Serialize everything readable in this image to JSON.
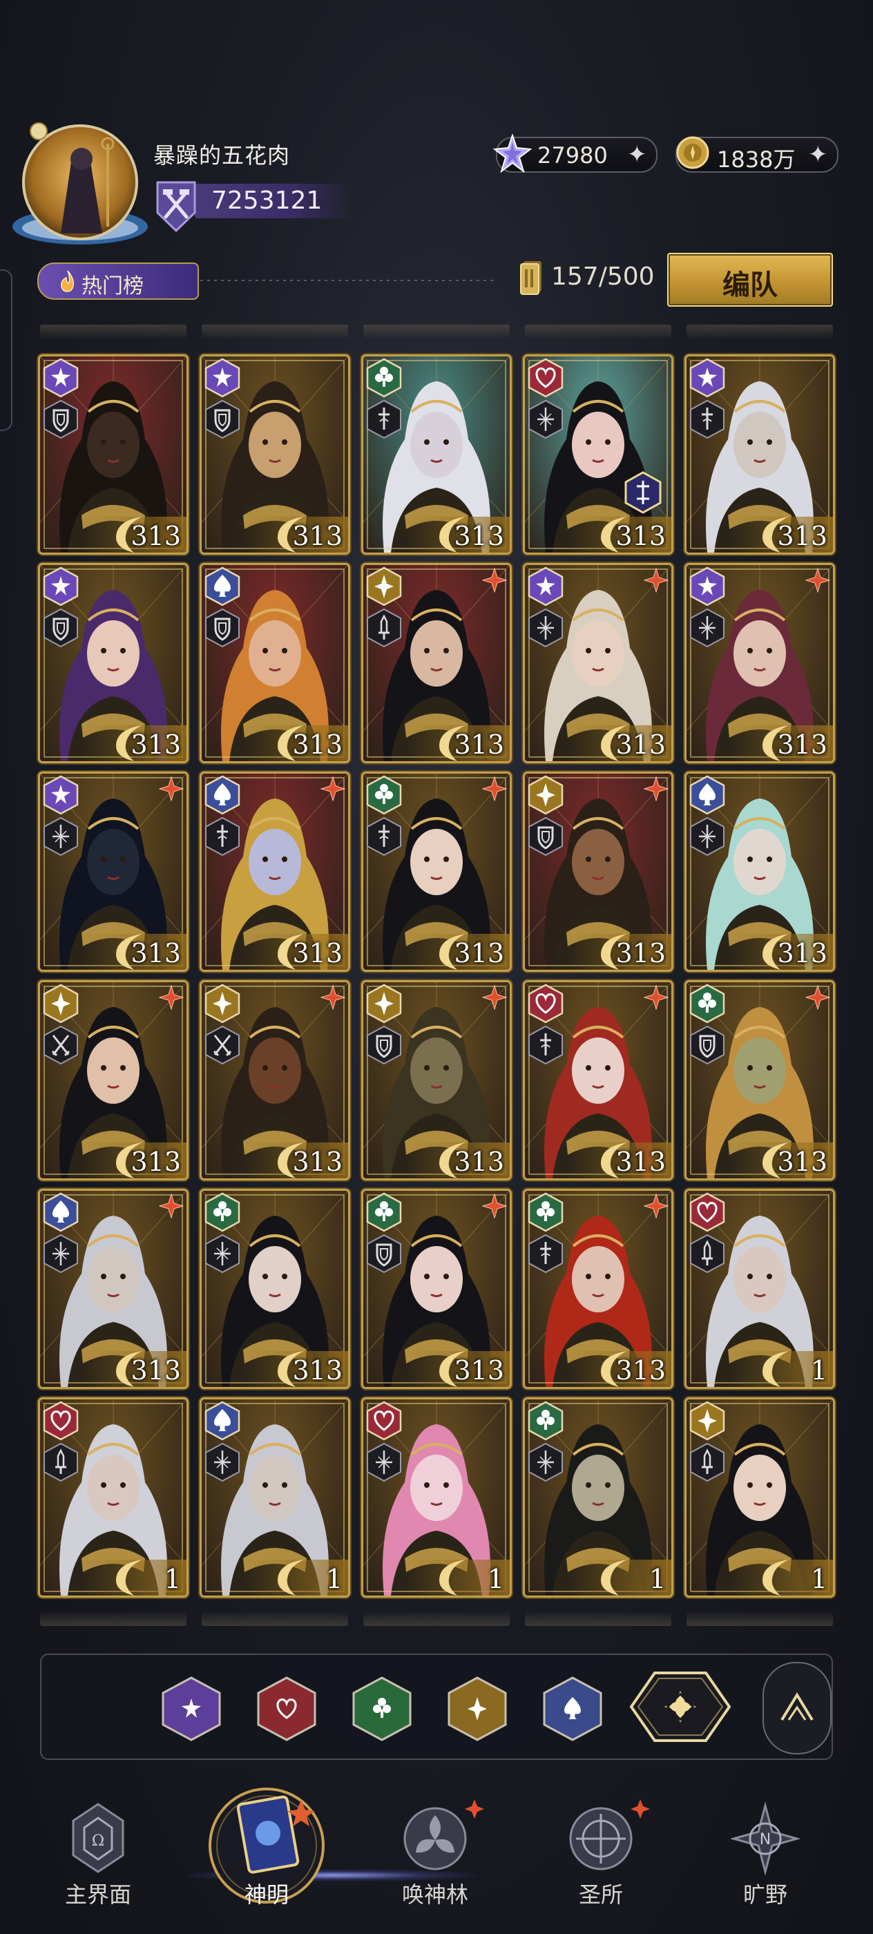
{
  "player": {
    "name": "暴躁的五花肉",
    "power": "7253121"
  },
  "resources": {
    "crystals": "27980",
    "gold": "1838万"
  },
  "header": {
    "hot_label": "热门榜",
    "card_count": "157/500",
    "team_button": "编队"
  },
  "cards": [
    {
      "suit": "star",
      "role": "shield",
      "level": "313",
      "bg": "#7a2a2a",
      "tone": "#3a2a20",
      "hair": "#1a1410",
      "extra": false,
      "star": false
    },
    {
      "suit": "star",
      "role": "shield",
      "level": "313",
      "bg": "#6a5020",
      "tone": "#c8a070",
      "hair": "#2a2018",
      "extra": false,
      "star": false
    },
    {
      "suit": "clover",
      "role": "sword",
      "level": "313",
      "bg": "#4a8a84",
      "tone": "#d8d0d8",
      "hair": "#e0e0e8",
      "extra": false,
      "star": false
    },
    {
      "suit": "heart",
      "role": "cross",
      "level": "313",
      "bg": "#5aa09a",
      "tone": "#e8c8c0",
      "hair": "#141418",
      "extra": true,
      "star": false
    },
    {
      "suit": "star",
      "role": "sword",
      "level": "313",
      "bg": "#6a5020",
      "tone": "#d0c8c0",
      "hair": "#d8d8e0",
      "extra": false,
      "star": false
    },
    {
      "suit": "star",
      "role": "shield",
      "level": "313",
      "bg": "#6a5020",
      "tone": "#e8c8b8",
      "hair": "#4a2a6a",
      "extra": false,
      "star": false
    },
    {
      "suit": "spade",
      "role": "shield",
      "level": "313",
      "bg": "#7a2a2a",
      "tone": "#e0b090",
      "hair": "#d08030",
      "extra": false,
      "star": false
    },
    {
      "suit": "diamond",
      "role": "dagger",
      "level": "313",
      "bg": "#7a2a2a",
      "tone": "#d8b8a0",
      "hair": "#141418",
      "extra": false,
      "star": true
    },
    {
      "suit": "star",
      "role": "cross",
      "level": "313",
      "bg": "#6a5020",
      "tone": "#e8d0c0",
      "hair": "#d8cfc0",
      "extra": false,
      "star": true
    },
    {
      "suit": "star",
      "role": "cross",
      "level": "313",
      "bg": "#6a5020",
      "tone": "#e0c0b0",
      "hair": "#6a2a3a",
      "extra": false,
      "star": true
    },
    {
      "suit": "star",
      "role": "cross",
      "level": "313",
      "bg": "#6a5020",
      "tone": "#202838",
      "hair": "#101420",
      "extra": false,
      "star": true
    },
    {
      "suit": "spade",
      "role": "sword",
      "level": "313",
      "bg": "#7a2a2a",
      "tone": "#b8b8d8",
      "hair": "#c8a040",
      "extra": false,
      "star": true
    },
    {
      "suit": "clover",
      "role": "sword",
      "level": "313",
      "bg": "#6a5020",
      "tone": "#e8d0c0",
      "hair": "#141418",
      "extra": false,
      "star": true
    },
    {
      "suit": "diamond",
      "role": "shield",
      "level": "313",
      "bg": "#7a2a2a",
      "tone": "#8a6040",
      "hair": "#2a2018",
      "extra": false,
      "star": true
    },
    {
      "suit": "spade",
      "role": "cross",
      "level": "313",
      "bg": "#6a5020",
      "tone": "#e0d8d0",
      "hair": "#a8d8d0",
      "extra": false,
      "star": false
    },
    {
      "suit": "diamond",
      "role": "swords",
      "level": "313",
      "bg": "#6a5020",
      "tone": "#e0c0a8",
      "hair": "#141418",
      "extra": false,
      "star": true
    },
    {
      "suit": "diamond",
      "role": "swords",
      "level": "313",
      "bg": "#6a5020",
      "tone": "#6a4028",
      "hair": "#2a2018",
      "extra": false,
      "star": true
    },
    {
      "suit": "diamond",
      "role": "shield",
      "level": "313",
      "bg": "#6a5020",
      "tone": "#7a7050",
      "hair": "#3a3420",
      "extra": false,
      "star": true
    },
    {
      "suit": "heart",
      "role": "sword",
      "level": "313",
      "bg": "#6a5020",
      "tone": "#e8d0c8",
      "hair": "#a02a20",
      "extra": false,
      "star": true
    },
    {
      "suit": "clover",
      "role": "shield",
      "level": "313",
      "bg": "#6a5020",
      "tone": "#a0a070",
      "hair": "#c09040",
      "extra": false,
      "star": true
    },
    {
      "suit": "spade",
      "role": "cross",
      "level": "313",
      "bg": "#6a5020",
      "tone": "#d0c8c0",
      "hair": "#c8c8d0",
      "extra": false,
      "star": true
    },
    {
      "suit": "clover",
      "role": "cross",
      "level": "313",
      "bg": "#6a5020",
      "tone": "#e0d0c8",
      "hair": "#141418",
      "extra": false,
      "star": false
    },
    {
      "suit": "clover",
      "role": "shield",
      "level": "313",
      "bg": "#6a5020",
      "tone": "#e8d0c8",
      "hair": "#141418",
      "extra": false,
      "star": true
    },
    {
      "suit": "clover",
      "role": "sword",
      "level": "313",
      "bg": "#6a5020",
      "tone": "#e0c0b0",
      "hair": "#b02818",
      "extra": false,
      "star": true
    },
    {
      "suit": "heart",
      "role": "dagger",
      "level": "1",
      "bg": "#6a5020",
      "tone": "#d8c8c0",
      "hair": "#d0d0d8",
      "extra": false,
      "star": false
    },
    {
      "suit": "heart",
      "role": "dagger",
      "level": "1",
      "bg": "#6a5020",
      "tone": "#d8c8c0",
      "hair": "#d0d0d8",
      "extra": false,
      "star": false
    },
    {
      "suit": "spade",
      "role": "cross",
      "level": "1",
      "bg": "#6a5020",
      "tone": "#d0c8c0",
      "hair": "#c8c8d0",
      "extra": false,
      "star": false
    },
    {
      "suit": "heart",
      "role": "cross",
      "level": "1",
      "bg": "#6a5020",
      "tone": "#f0d0d8",
      "hair": "#e088b0",
      "extra": false,
      "star": false
    },
    {
      "suit": "clover",
      "role": "cross",
      "level": "1",
      "bg": "#6a5020",
      "tone": "#b0a890",
      "hair": "#1a1a18",
      "extra": false,
      "star": false
    },
    {
      "suit": "diamond",
      "role": "dagger",
      "level": "1",
      "bg": "#6a5020",
      "tone": "#e8d0c0",
      "hair": "#141418",
      "extra": false,
      "star": false
    }
  ],
  "filters": [
    {
      "icon": "star-filter-icon",
      "color": "#5b3f9a"
    },
    {
      "icon": "heart-filter-icon",
      "color": "#8a2a30"
    },
    {
      "icon": "clover-filter-icon",
      "color": "#2a6a3a"
    },
    {
      "icon": "diamond-filter-icon",
      "color": "#8a6a20"
    },
    {
      "icon": "spade-filter-icon",
      "color": "#3a4a8a"
    }
  ],
  "nav": [
    {
      "label": "主界面",
      "icon": "main-world-icon"
    },
    {
      "label": "神明",
      "icon": "gods-card-icon"
    },
    {
      "label": "唤神林",
      "icon": "summon-forest-icon"
    },
    {
      "label": "圣所",
      "icon": "sanctuary-icon"
    },
    {
      "label": "旷野",
      "icon": "wilderness-compass-icon"
    }
  ]
}
